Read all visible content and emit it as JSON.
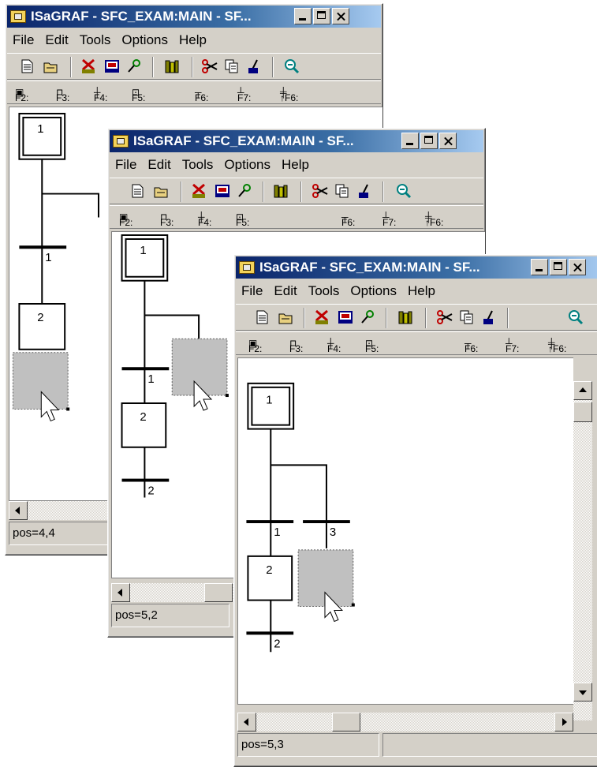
{
  "windows": [
    {
      "id": "w1",
      "title": "ISaGRAF - SFC_EXAM:MAIN - SF...",
      "status": "pos=4,4",
      "steps": [
        {
          "label": "1"
        },
        {
          "label": "2"
        }
      ],
      "transitions": [
        {
          "label": "1"
        }
      ]
    },
    {
      "id": "w2",
      "title": "ISaGRAF - SFC_EXAM:MAIN - SF...",
      "status": "pos=5,2",
      "steps": [
        {
          "label": "1"
        },
        {
          "label": "2"
        }
      ],
      "transitions": [
        {
          "label": "1"
        },
        {
          "label": "2"
        }
      ]
    },
    {
      "id": "w3",
      "title": "ISaGRAF - SFC_EXAM:MAIN - SF...",
      "status": "pos=5,3",
      "steps": [
        {
          "label": "1"
        },
        {
          "label": "2"
        }
      ],
      "transitions": [
        {
          "label": "1"
        },
        {
          "label": "3"
        },
        {
          "label": "2"
        }
      ]
    }
  ],
  "menu": [
    "File",
    "Edit",
    "Tools",
    "Options",
    "Help"
  ],
  "toolbar_icons": [
    "new-file-icon",
    "open-file-icon",
    "compile-icon",
    "simulate-icon",
    "debug-icon",
    "dictionary-icon",
    "cut-icon",
    "copy-icon",
    "paste-icon",
    "zoom-icon"
  ],
  "shortcuts": [
    "F2:",
    "F3:",
    "F4:",
    "F5:",
    "F6:",
    "F7:",
    "↑F6:"
  ],
  "colors": {
    "title_start": "#0a246a",
    "title_end": "#a6caf0",
    "face": "#d4d0c8",
    "selection": "#c0c0c0"
  }
}
